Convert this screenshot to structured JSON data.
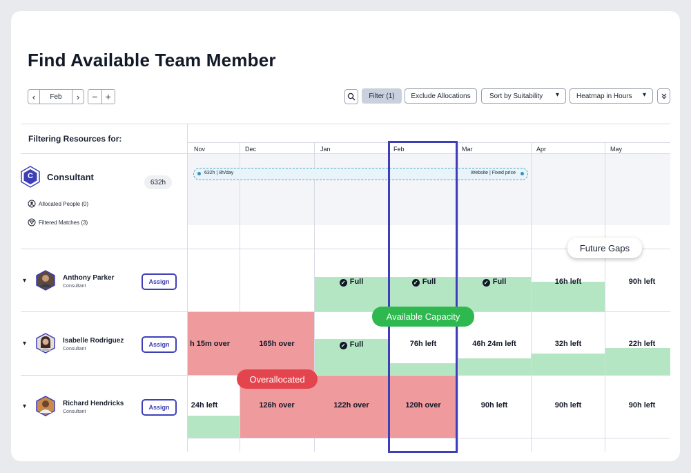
{
  "page_title": "Find Available Team Member",
  "toolbar": {
    "prev": "‹",
    "month": "Feb",
    "next": "›",
    "zoom_out": "−",
    "zoom_in": "+",
    "filter": "Filter (1)",
    "exclude": "Exclude Allocations",
    "sort": "Sort by Suitability",
    "heatmap": "Heatmap in Hours",
    "chevron": "▾",
    "collapse": "⌄"
  },
  "sidebar": {
    "heading": "Filtering Resources for:",
    "role_initial": "C",
    "role_name": "Consultant",
    "hours_badge": "632h",
    "allocated": "Allocated People (0)",
    "matches": "Filtered Matches (3)"
  },
  "months": [
    "Nov",
    "Dec",
    "Jan",
    "Feb",
    "Mar",
    "Apr",
    "May"
  ],
  "project_bar": {
    "left_label": "632h | 8h/day",
    "right_label": "Website | Fixed price"
  },
  "people": [
    {
      "name": "Anthony Parker",
      "role": "Consultant",
      "assign": "Assign",
      "cells": [
        "",
        "",
        "Full",
        "Full",
        "Full",
        "16h left",
        "90h left"
      ]
    },
    {
      "name": "Isabelle Rodriguez",
      "role": "Consultant",
      "assign": "Assign",
      "cells": [
        "h 15m over",
        "165h over",
        "Full",
        "76h left",
        "46h 24m left",
        "32h left",
        "22h left"
      ]
    },
    {
      "name": "Richard Hendricks",
      "role": "Consultant",
      "assign": "Assign",
      "cells": [
        "24h left",
        "126h over",
        "122h over",
        "120h over",
        "90h left",
        "90h left",
        "90h left"
      ]
    }
  ],
  "callouts": {
    "future_gaps": "Future Gaps",
    "available_capacity": "Available Capacity",
    "overallocated": "Overallocated"
  },
  "colors": {
    "accent": "#3e3fb8",
    "over": "#ef9a9d",
    "available": "#b5e6c3",
    "callout_green": "#2fb84f",
    "callout_red": "#e4444e"
  }
}
